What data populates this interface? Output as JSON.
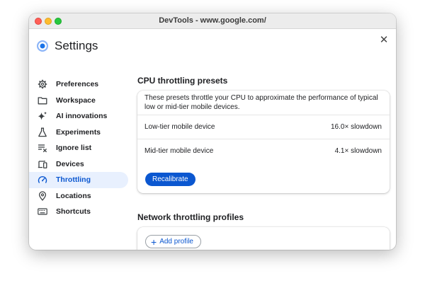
{
  "window": {
    "title": "DevTools - www.google.com/"
  },
  "sidebar": {
    "title": "Settings",
    "items": [
      {
        "label": "Preferences",
        "icon": "gear-icon"
      },
      {
        "label": "Workspace",
        "icon": "folder-icon"
      },
      {
        "label": "AI innovations",
        "icon": "sparkle-icon"
      },
      {
        "label": "Experiments",
        "icon": "flask-icon"
      },
      {
        "label": "Ignore list",
        "icon": "filter-list-icon"
      },
      {
        "label": "Devices",
        "icon": "devices-icon"
      },
      {
        "label": "Throttling",
        "icon": "speedometer-icon",
        "active": true
      },
      {
        "label": "Locations",
        "icon": "location-pin-icon"
      },
      {
        "label": "Shortcuts",
        "icon": "keyboard-icon"
      }
    ]
  },
  "cpu": {
    "title": "CPU throttling presets",
    "description": "These presets throttle your CPU to approximate the performance of typical low or mid-tier mobile devices.",
    "presets": [
      {
        "name": "Low-tier mobile device",
        "value": "16.0× slowdown"
      },
      {
        "name": "Mid-tier mobile device",
        "value": "4.1× slowdown"
      }
    ],
    "recalibrate_label": "Recalibrate"
  },
  "network": {
    "title": "Network throttling profiles",
    "add_profile_label": "Add profile"
  },
  "colors": {
    "accent": "#0b57d0",
    "active_bg": "#e8f0fe"
  }
}
